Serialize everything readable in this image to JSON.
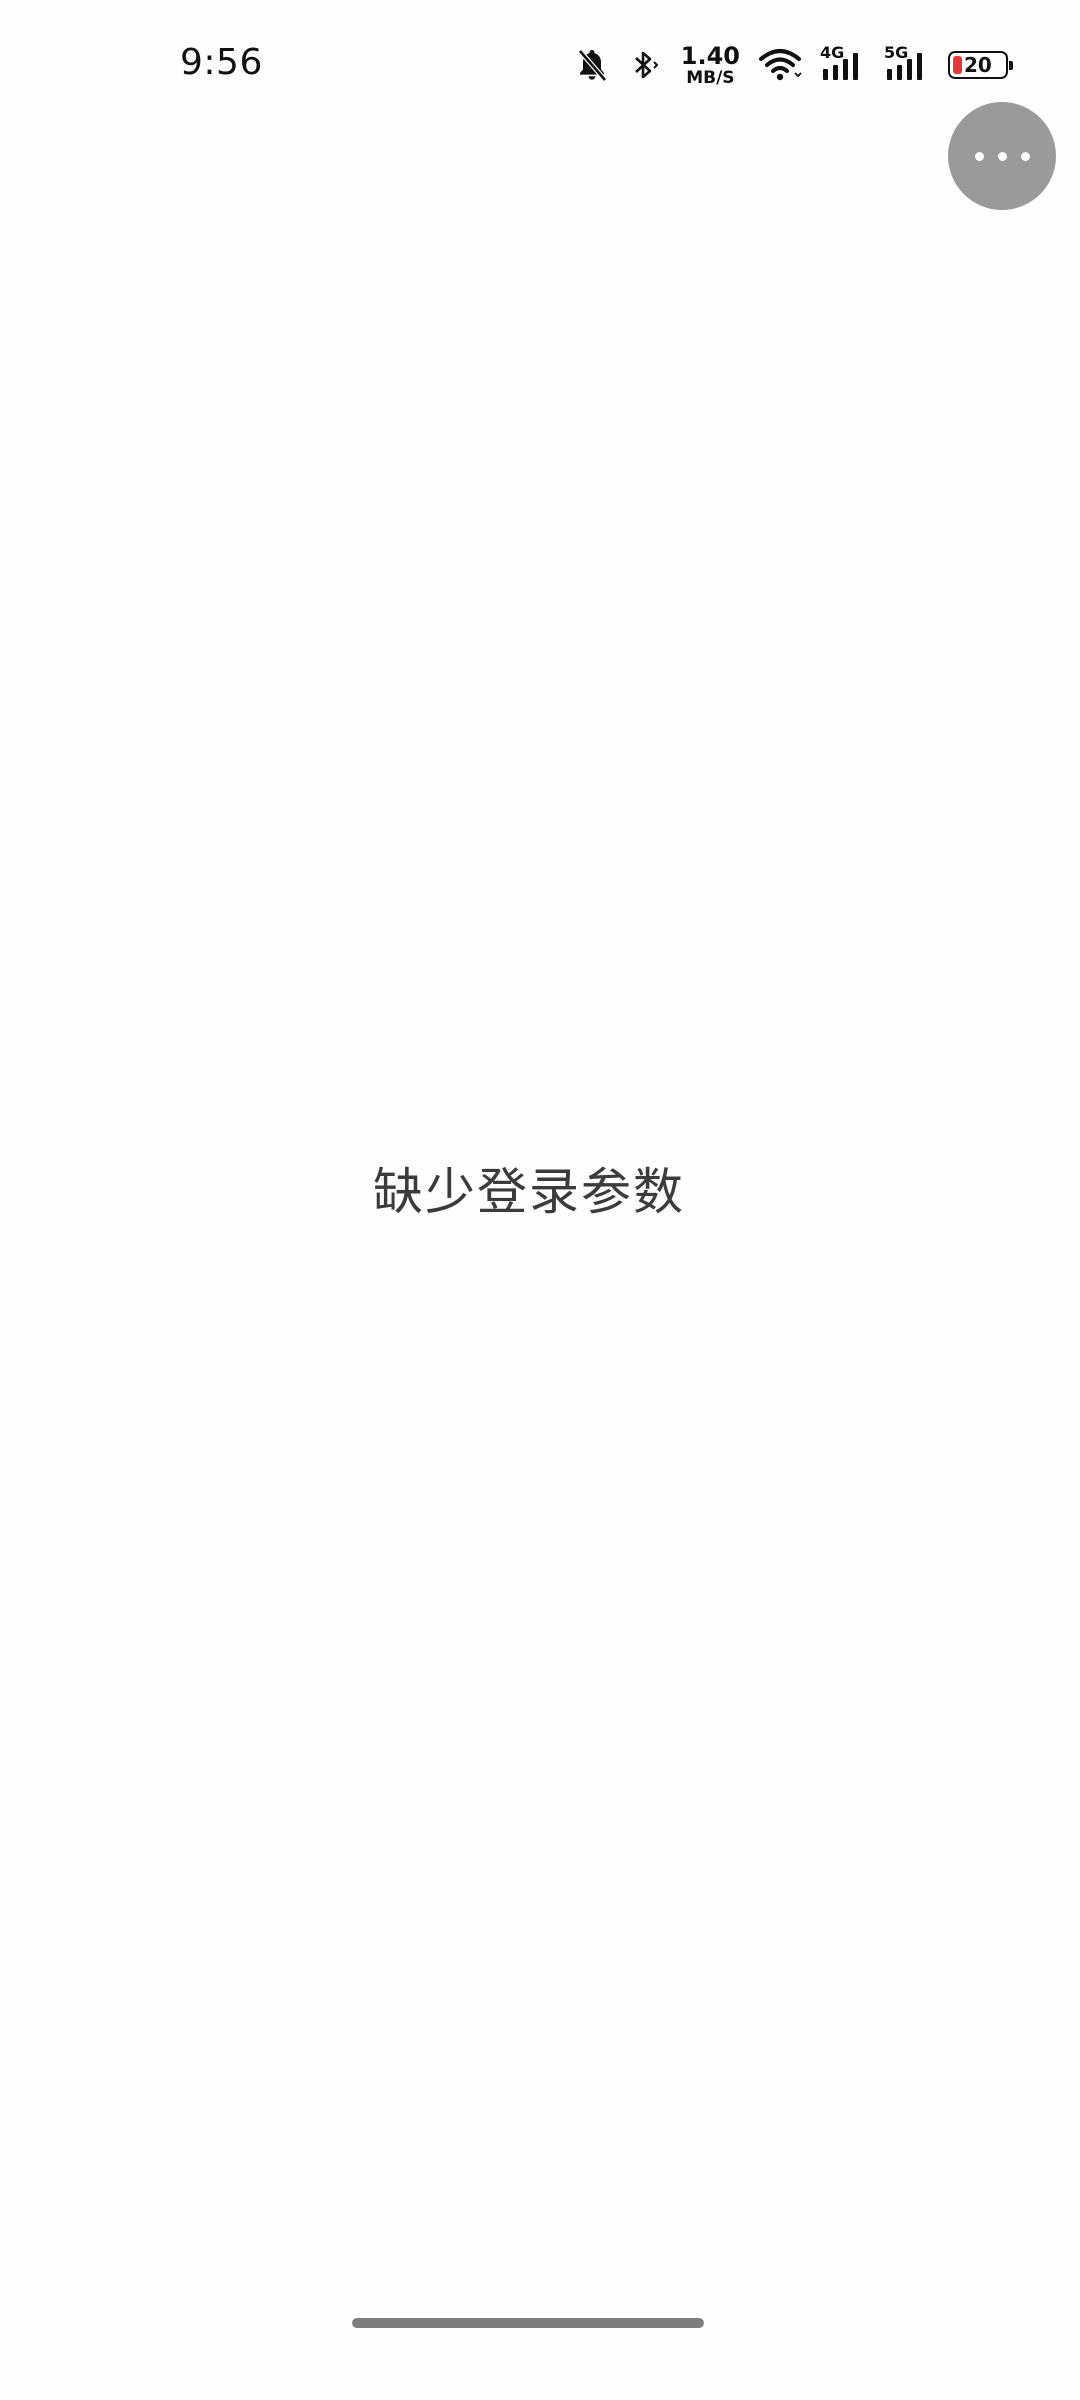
{
  "status_bar": {
    "time": "9:56",
    "net_speed_value": "1.40",
    "net_speed_unit": "MB/S",
    "signal_1_tag": "4G",
    "signal_2_tag": "5G",
    "battery_level": "20",
    "battery_color": "#e5383b",
    "icons": [
      "bell-muted-icon",
      "bluetooth-icon",
      "wifi-icon",
      "signal-4g-icon",
      "signal-5g-icon",
      "battery-icon"
    ]
  },
  "menu_button": {
    "icon": "more-dots-icon"
  },
  "main": {
    "message": "缺少登录参数"
  }
}
